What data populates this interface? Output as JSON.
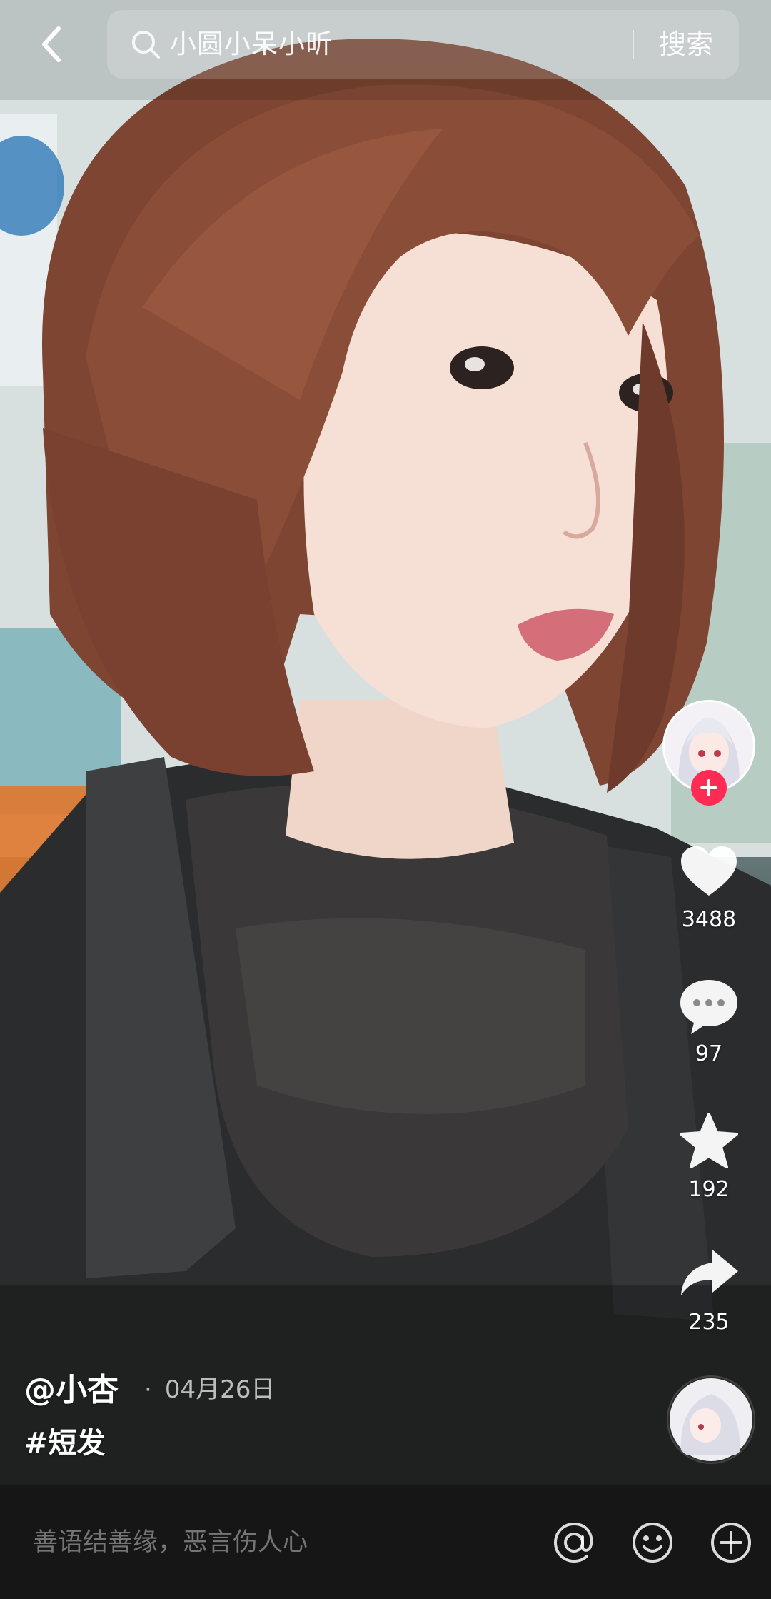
{
  "top_bar": {
    "search_query": "小圆小呆小昕",
    "search_button_label": "搜索"
  },
  "actions": {
    "likes": "3488",
    "comments": "97",
    "favorites": "192",
    "shares": "235"
  },
  "post": {
    "author": "@小杏",
    "date": "04月26日",
    "hashtag": "#短发"
  },
  "comment_bar": {
    "placeholder": "善语结善缘，恶言伤人心"
  },
  "icons": {
    "back": "chevron-left-icon",
    "search": "search-icon",
    "follow": "plus-icon",
    "like": "heart-icon",
    "comment": "chat-bubble-icon",
    "favorite": "star-icon",
    "share": "share-arrow-icon",
    "mention": "at-icon",
    "emoji": "emoji-icon",
    "add": "plus-circle-icon"
  },
  "colors": {
    "accent": "#fe2c55",
    "bottom_bar": "#161616",
    "text": "#ffffff"
  }
}
